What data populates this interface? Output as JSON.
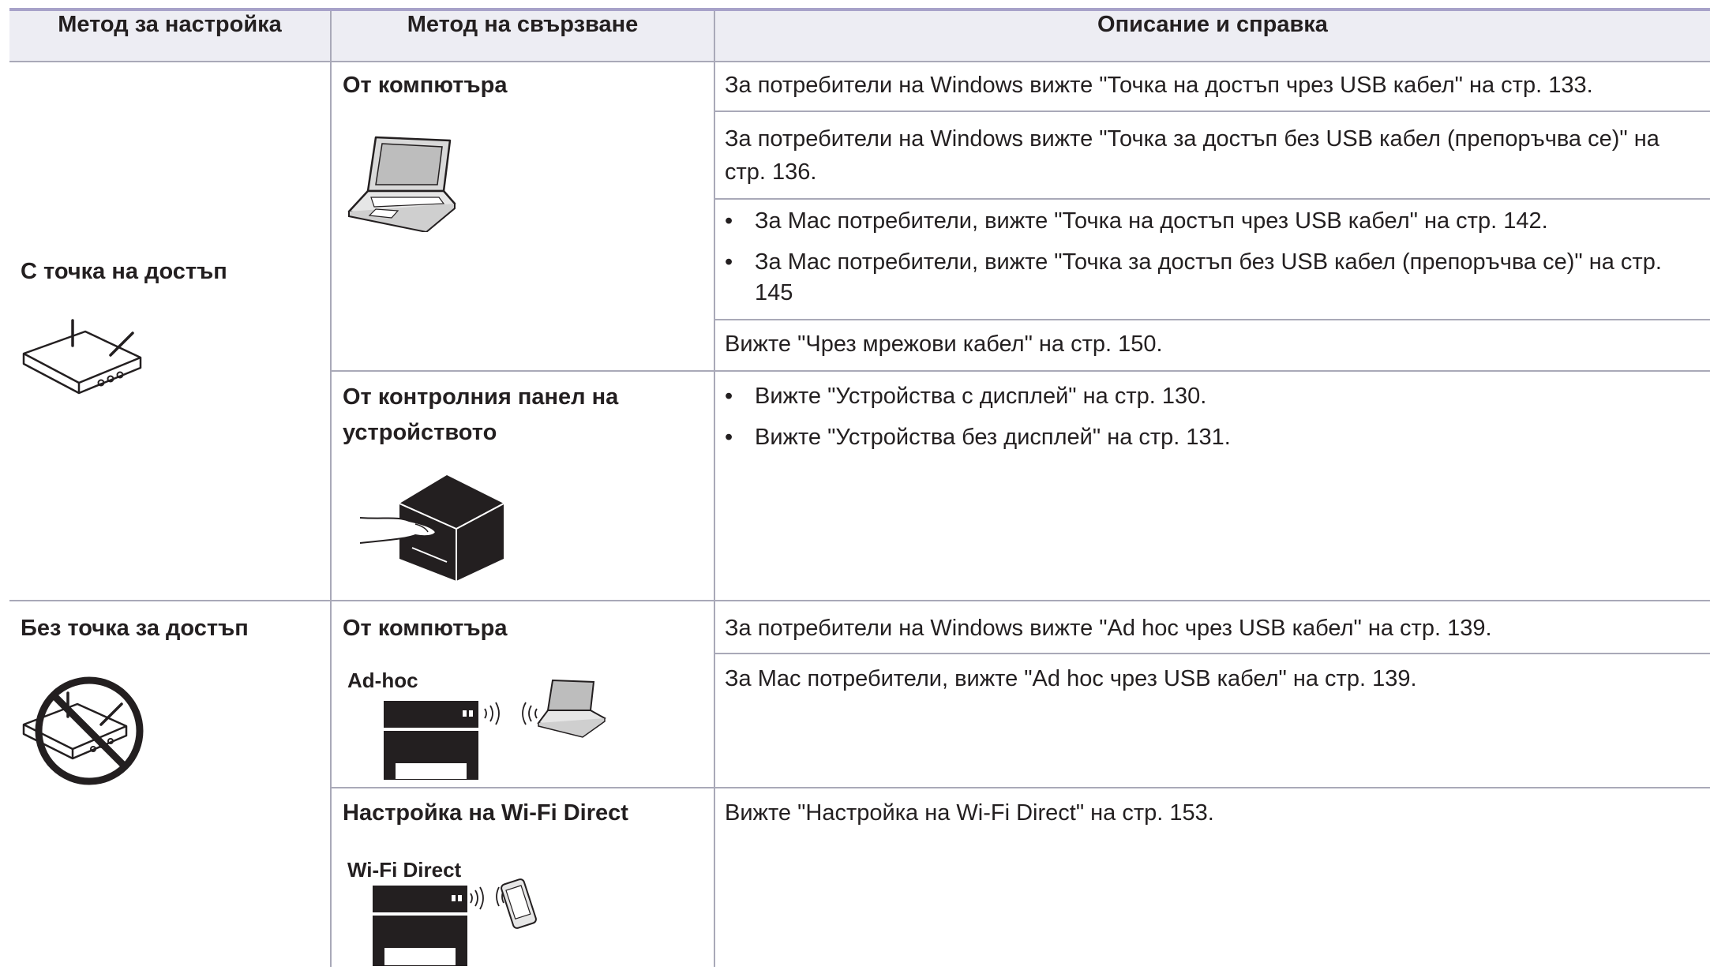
{
  "table": {
    "headers": [
      "Метод за настройка",
      "Метод на свързване",
      "Описание и справка"
    ],
    "setup_methods": {
      "with_ap": "С точка на достъп",
      "without_ap": "Без точка за достъп"
    },
    "connections": {
      "from_computer": "От компютъра",
      "from_panel": "От контролния панел на устройството",
      "from_computer_2": "От компютъра",
      "wifi_direct": "Настройка на Wi-Fi Direct"
    },
    "image_labels": {
      "adhoc": "Ad-hoc",
      "wifi_direct": "Wi-Fi Direct"
    },
    "descriptions": {
      "win_usb_ap": "За потребители на Windows вижте \"Точка на достъп чрез USB кабел\" на стр. 133.",
      "win_nousb_ap_1": "За потребители на Windows вижте \"Точка за достъп без USB кабел (препоръчва се)\" на",
      "win_nousb_ap_2": "стр. 136.",
      "mac_usb_ap": "За Mac потребители, вижте \"Точка на достъп чрез USB кабел\" на стр. 142.",
      "mac_nousb_ap_1": "За Mac потребители, вижте \"Точка за достъп без USB кабел (препоръчва се)\" на стр.",
      "mac_nousb_ap_2": "145",
      "cable": "Вижте \"Чрез мрежови кабел\" на стр. 150.",
      "display_devices": "Вижте \"Устройства с дисплей\" на стр. 130.",
      "no_display_devices": "Вижте \"Устройства без дисплей\" на стр. 131.",
      "win_adhoc": "За потребители на Windows вижте \"Ad hoc чрез USB кабел\" на стр. 139.",
      "mac_adhoc": "За Mac потребители, вижте \"Ad hoc чрез USB кабел\" на стр. 139.",
      "wifi_direct": "Вижте \"Настройка на Wi-Fi Direct\" на стр. 153."
    },
    "bullet_symbol": "•",
    "colors": {
      "header_bg": "#ededf3",
      "top_rule": "#a7a2c9",
      "grid": "#a9a9b8",
      "text": "#231f20"
    },
    "icons": [
      "laptop-icon",
      "router-icon",
      "printer-hand-icon",
      "no-router-icon",
      "adhoc-printer-icon",
      "wifi-direct-icon"
    ]
  }
}
